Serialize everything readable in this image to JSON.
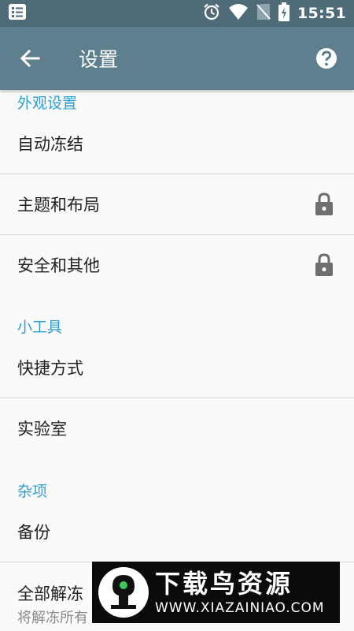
{
  "status_bar": {
    "time": "15:51",
    "icons": [
      "notes-icon",
      "alarm-icon",
      "wifi-icon",
      "no-sim-icon",
      "battery-charging-icon"
    ]
  },
  "app_bar": {
    "title": "设置",
    "icons": [
      "back-arrow-icon",
      "help-icon"
    ]
  },
  "sections": [
    {
      "header": "外观设置",
      "items": [
        {
          "label": "自动冻结",
          "locked": false
        },
        {
          "label": "主题和布局",
          "locked": true
        },
        {
          "label": "安全和其他",
          "locked": true
        }
      ]
    },
    {
      "header": "小工具",
      "items": [
        {
          "label": "快捷方式",
          "locked": false
        },
        {
          "label": "实验室",
          "locked": false
        }
      ]
    },
    {
      "header": "杂项",
      "items": [
        {
          "label": "备份",
          "locked": false
        },
        {
          "label": "全部解冻",
          "sublabel": "将解冻所有",
          "locked": false
        }
      ]
    }
  ],
  "watermark": {
    "title": "下载鸟资源",
    "url": "WWW.XIAZAINIAO.COM"
  },
  "colors": {
    "status_bar": "#4f6b78",
    "app_bar": "#5e7f8d",
    "section_header": "#2f9fcf",
    "background": "#fafafa"
  }
}
